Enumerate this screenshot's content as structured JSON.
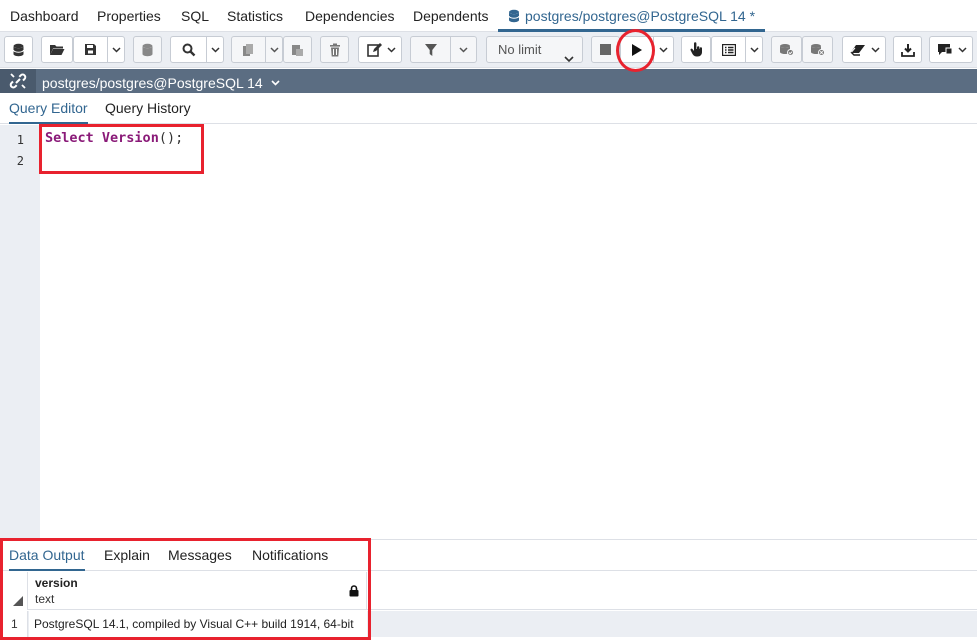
{
  "top_tabs": [
    {
      "label": "Dashboard"
    },
    {
      "label": "Properties"
    },
    {
      "label": "SQL"
    },
    {
      "label": "Statistics"
    },
    {
      "label": "Dependencies"
    },
    {
      "label": "Dependents"
    },
    {
      "label": "postgres/postgres@PostgreSQL 14 *",
      "icon": "database-icon",
      "active": true
    }
  ],
  "toolbar": {
    "limit_select": {
      "value": "No limit"
    },
    "icons": [
      "database-icon",
      "folder-open-icon",
      "save-icon",
      "chevron-down-icon",
      "database-disabled-icon",
      "search-icon",
      "chevron-down-icon",
      "copy-icon",
      "chevron-down-icon",
      "paste-icon",
      "delete-icon",
      "edit-icon",
      "chevron-down-icon",
      "filter-icon",
      "chevron-down-icon",
      "stop-icon",
      "play-icon",
      "chevron-down-icon",
      "pointer-hand-icon",
      "list-icon",
      "chevron-down-icon",
      "commit-icon",
      "rollback-icon",
      "eraser-icon",
      "chevron-down-icon",
      "download-icon",
      "macros-icon",
      "chevron-down-icon"
    ]
  },
  "connection": {
    "label": "postgres/postgres@PostgreSQL 14",
    "icon": "connection-link-icon"
  },
  "editor_tabs": [
    {
      "label": "Query Editor",
      "active": true
    },
    {
      "label": "Query History"
    }
  ],
  "editor": {
    "line_numbers": [
      "1",
      "2"
    ],
    "code": {
      "keyword1": "Select",
      "func": "Version",
      "punct": "();"
    }
  },
  "output_tabs": [
    {
      "label": "Data Output",
      "active": true
    },
    {
      "label": "Explain"
    },
    {
      "label": "Messages"
    },
    {
      "label": "Notifications"
    }
  ],
  "grid": {
    "columns": [
      {
        "name": "version",
        "type": "text",
        "icon": "lock-icon"
      }
    ],
    "rows": [
      {
        "num": "1",
        "values": [
          "PostgreSQL 14.1, compiled by Visual C++ build 1914, 64-bit"
        ]
      }
    ]
  },
  "colors": {
    "accent": "#326690",
    "toolbar_bg": "#ebeef3",
    "connection_bar": "#5b6d82",
    "keyword": "#8a1a78",
    "annotation": "#e8222e"
  }
}
